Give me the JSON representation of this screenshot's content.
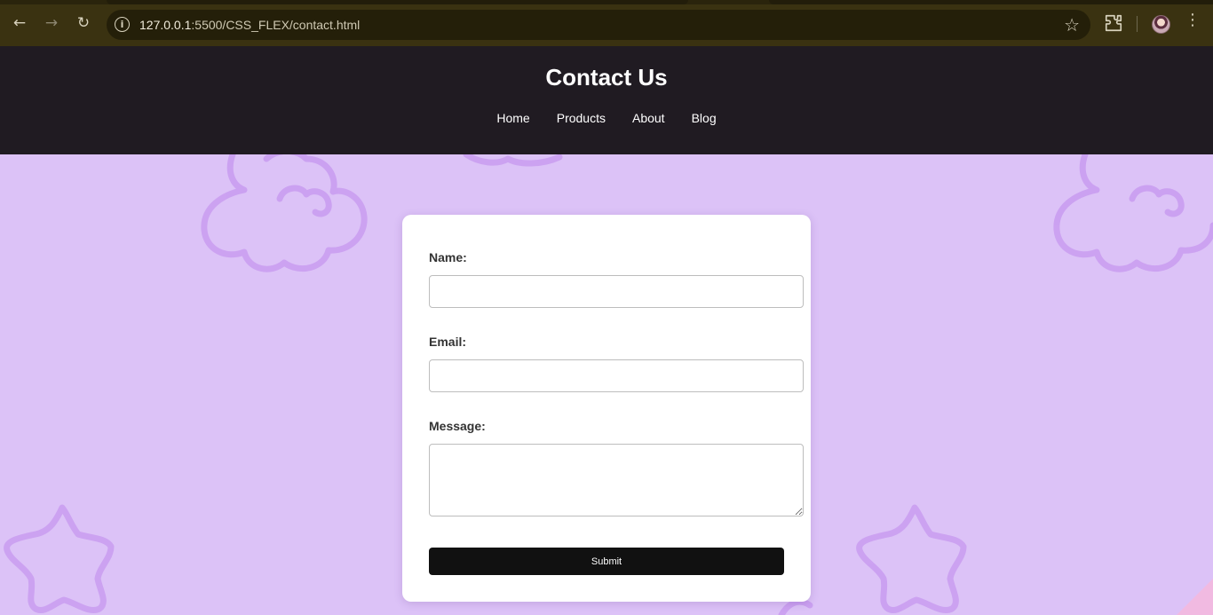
{
  "browser": {
    "url_host": "127.0.0.1",
    "url_path": ":5500/CSS_FLEX/contact.html",
    "icons": [
      "back-arrow-icon",
      "forward-arrow-icon",
      "reload-icon",
      "site-info-icon",
      "bookmark-star-icon",
      "extensions-icon",
      "profile-avatar",
      "kebab-menu-icon"
    ]
  },
  "header": {
    "title": "Contact Us",
    "nav": [
      "Home",
      "Products",
      "About",
      "Blog"
    ]
  },
  "form": {
    "name_label": "Name:",
    "name_value": "",
    "email_label": "Email:",
    "email_value": "",
    "message_label": "Message:",
    "message_value": "",
    "submit_label": "Submit"
  },
  "colors": {
    "chrome": "#3a3211",
    "header_bg": "#201b22",
    "page_bg": "#dcc2f7",
    "doodle": "#c99cf0",
    "card_bg": "#ffffff",
    "button_bg": "#111111"
  }
}
